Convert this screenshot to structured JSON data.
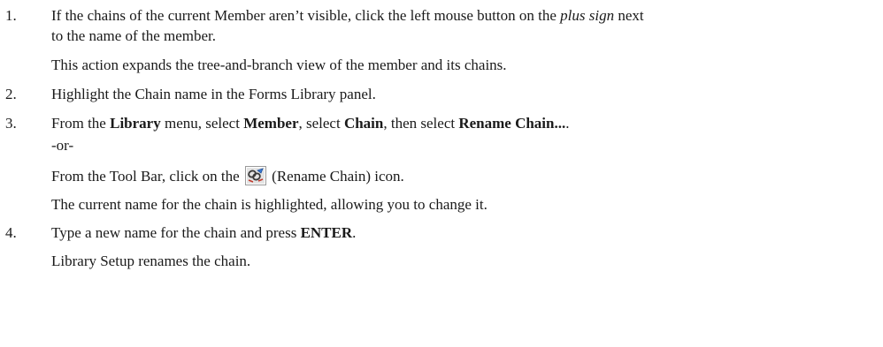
{
  "steps": [
    {
      "number": "1.",
      "line1_text": "If the chains of the current Member aren’t visible, click the left mouse button on the ",
      "line1_italic": "plus sign",
      "line1_after": " next",
      "line2": "to the name of the member.",
      "note": "This action expands the tree-and-branch view of the member and its chains."
    },
    {
      "number": "2.",
      "text": "Highlight the Chain name in the Forms Library panel."
    },
    {
      "number": "3.",
      "text_a": "From the ",
      "bold_library": "Library",
      "text_b": " menu, select ",
      "bold_member": "Member",
      "text_c": ", select ",
      "bold_chain": "Chain",
      "text_d": ", then select ",
      "bold_rename": "Rename Chain...",
      "text_e": ".",
      "or": "-or-",
      "toolbar_a": "From the Tool Bar, click on the ",
      "toolbar_b": " (Rename Chain) icon.",
      "icon": "rename-chain-icon",
      "note": "The current name for the chain is highlighted, allowing you to change it."
    },
    {
      "number": "4.",
      "text_a": "Type a new name for the chain and press ",
      "bold_enter": "ENTER",
      "text_b": ".",
      "note": "Library Setup renames the chain."
    }
  ]
}
